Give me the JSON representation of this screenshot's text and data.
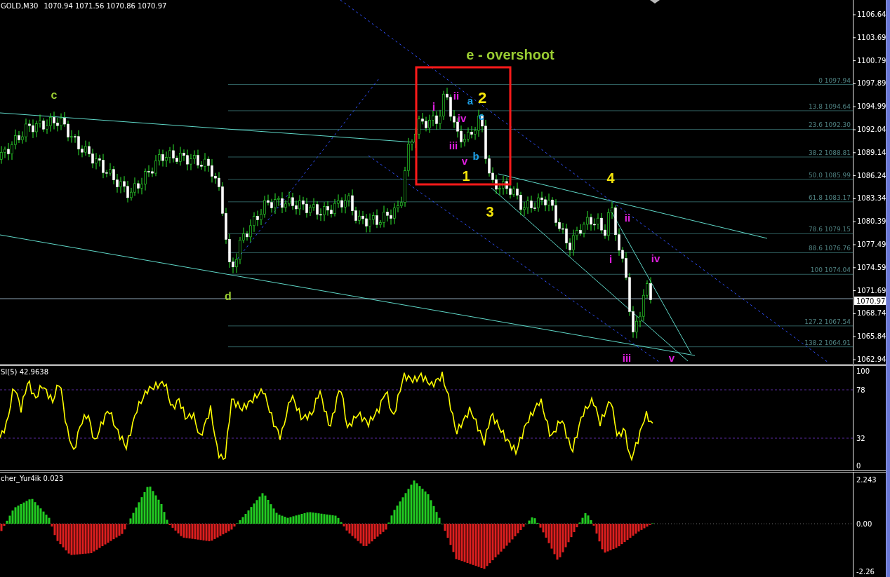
{
  "chart": {
    "symbol": "GOLD,M30",
    "ohlc": "1070.94 1071.56 1070.86 1070.97"
  },
  "price_axis": [
    "1106.64",
    "1103.69",
    "1100.79",
    "1097.89",
    "1094.99",
    "1092.04",
    "1089.14",
    "1086.24",
    "1083.34",
    "1080.39",
    "1077.49",
    "1074.59",
    "1071.69",
    "1068.74",
    "1065.84",
    "1062.94"
  ],
  "current_price": "1070.97",
  "fib_levels": [
    {
      "label": "0 1097.94"
    },
    {
      "label": "13.8 1094.64"
    },
    {
      "label": "23.6 1092.30"
    },
    {
      "label": "38.2 1088.81"
    },
    {
      "label": "50.0 1085.99"
    },
    {
      "label": "61.8 1083.17"
    },
    {
      "label": "78.6 1079.15"
    },
    {
      "label": "88.6 1076.76"
    },
    {
      "label": "100 1074.04"
    },
    {
      "label": "127.2 1067.54"
    },
    {
      "label": "138.2 1064.91"
    }
  ],
  "wave_labels": [
    {
      "text": "c",
      "color": "#9acd32"
    },
    {
      "text": "d",
      "color": "#9acd32"
    },
    {
      "text": "e - overshoot",
      "color": "#9acd32"
    },
    {
      "text": "ii",
      "color": "#e020e0"
    },
    {
      "text": "a",
      "color": "#1ea0e8"
    },
    {
      "text": "2",
      "color": "#f5e50a"
    },
    {
      "text": "i",
      "color": "#e020e0"
    },
    {
      "text": "iv",
      "color": "#e020e0"
    },
    {
      "text": "c",
      "color": "#1ea0e8"
    },
    {
      "text": "iii",
      "color": "#e020e0"
    },
    {
      "text": "b",
      "color": "#1ea0e8"
    },
    {
      "text": "v",
      "color": "#e020e0"
    },
    {
      "text": "1",
      "color": "#f5e50a"
    },
    {
      "text": "3",
      "color": "#f5e50a"
    },
    {
      "text": "4",
      "color": "#f5e50a"
    },
    {
      "text": "ii",
      "color": "#e020e0"
    },
    {
      "text": "i",
      "color": "#e020e0"
    },
    {
      "text": "iv",
      "color": "#e020e0"
    },
    {
      "text": "iii",
      "color": "#e020e0"
    },
    {
      "text": "v",
      "color": "#e020e0"
    }
  ],
  "rsi": {
    "header": "SI(5) 42.9638",
    "axis": [
      "100",
      "78",
      "32",
      "0"
    ]
  },
  "oscillator": {
    "header": "cher_Yur4ik 0.023",
    "axis": [
      "2.243",
      "0.00",
      "-2.26"
    ]
  }
}
